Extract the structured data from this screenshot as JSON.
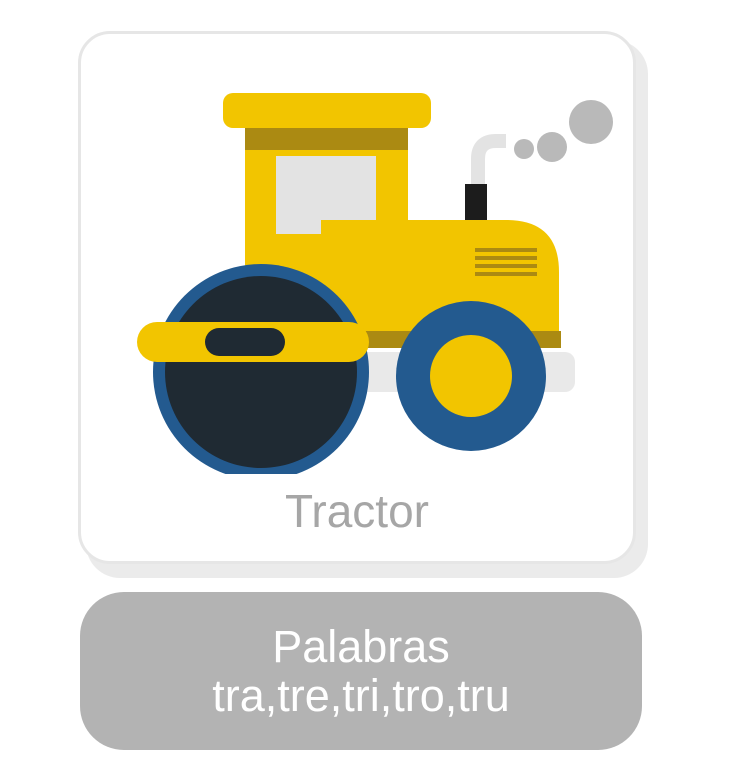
{
  "card": {
    "caption": "Tractor",
    "icon": "tractor-icon"
  },
  "label": {
    "line1": "Palabras",
    "line2": "tra,tre,tri,tro,tru"
  },
  "colors": {
    "body_yellow": "#f2c500",
    "dark_band": "#ab8a12",
    "wheel_blue": "#235a8f",
    "drum_dark": "#1f2a33",
    "window": "#e3e3e3",
    "smoke": "#b9b9b9",
    "caption_gray": "#a6a6a6",
    "pill_gray": "#b3b3b3"
  }
}
